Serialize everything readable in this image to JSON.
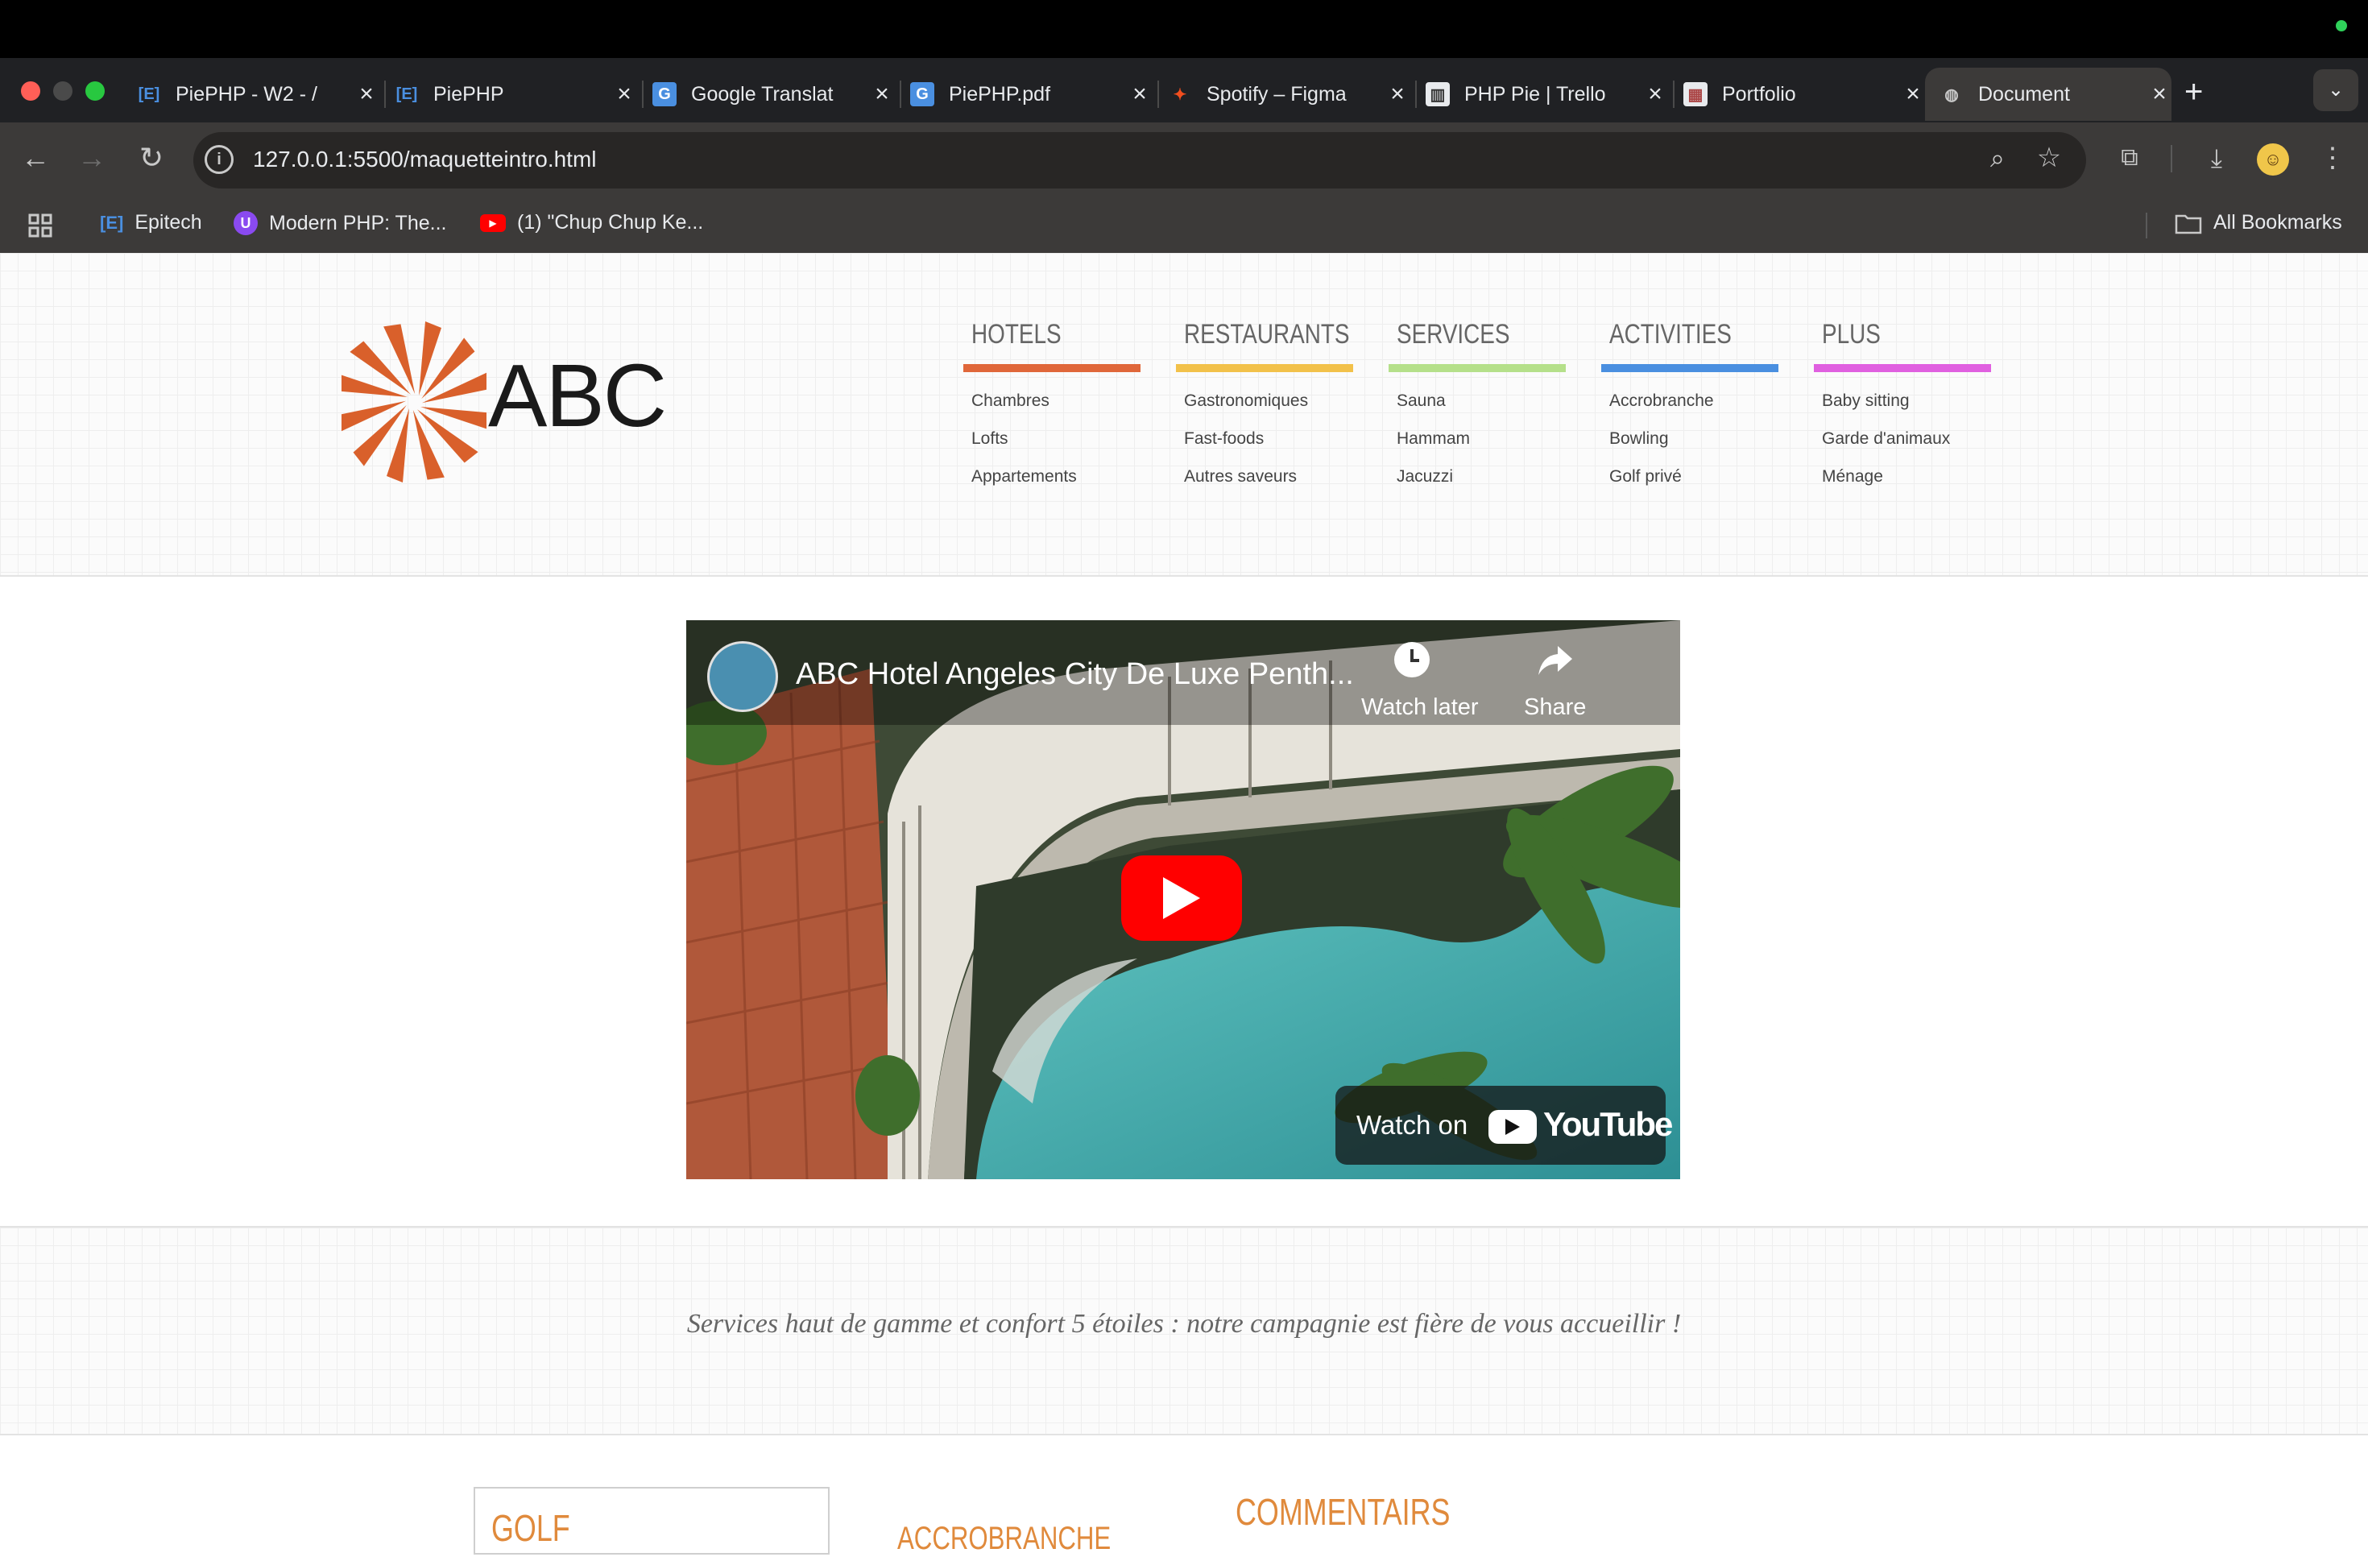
{
  "browser": {
    "tabs": [
      {
        "label": "PiePHP - W2 - /",
        "icon": "epitech-icon",
        "active": false
      },
      {
        "label": "PiePHP",
        "icon": "epitech-icon",
        "active": false
      },
      {
        "label": "Google Translat",
        "icon": "google-translate-icon",
        "active": false
      },
      {
        "label": "PiePHP.pdf",
        "icon": "google-translate-icon",
        "active": false
      },
      {
        "label": "Spotify – Figma",
        "icon": "figma-icon",
        "active": false
      },
      {
        "label": "PHP Pie | Trello",
        "icon": "trello-icon",
        "active": false
      },
      {
        "label": "Portfolio",
        "icon": "portfolio-icon",
        "active": false
      },
      {
        "label": "Document",
        "icon": "globe-icon",
        "active": true
      }
    ],
    "url": "127.0.0.1:5500/maquetteintro.html",
    "bookmarks": [
      {
        "label": "Epitech",
        "icon": "epitech-icon"
      },
      {
        "label": "Modern PHP: The...",
        "icon": "udemy-icon"
      },
      {
        "label": "(1) \"Chup Chup Ke...",
        "icon": "youtube-icon"
      }
    ],
    "all_bookmarks_label": "All Bookmarks"
  },
  "site": {
    "logo_text": "ABC",
    "nav": [
      {
        "title": "HOTELS",
        "color": "#e0673a",
        "items": [
          "Chambres",
          "Lofts",
          "Appartements"
        ]
      },
      {
        "title": "RESTAURANTS",
        "color": "#f2c14a",
        "items": [
          "Gastronomiques",
          "Fast-foods",
          "Autres saveurs"
        ]
      },
      {
        "title": "SERVICES",
        "color": "#b5e08a",
        "items": [
          "Sauna",
          "Hammam",
          "Jacuzzi"
        ]
      },
      {
        "title": "ACTIVITIES",
        "color": "#4a8fe0",
        "items": [
          "Accrobranche",
          "Bowling",
          "Golf privé"
        ]
      },
      {
        "title": "PLUS",
        "color": "#e060e0",
        "items": [
          "Baby sitting",
          "Garde d'animaux",
          "Ménage"
        ]
      }
    ],
    "video": {
      "title": "ABC Hotel Angeles City De Luxe Penth...",
      "watch_later": "Watch later",
      "share": "Share",
      "watch_on": "Watch on",
      "youtube": "YouTube"
    },
    "slogan": "Services haut de gamme et confort 5 étoiles : notre campagnie est fière de vous accueillir !",
    "sections": {
      "golf": "GOLF",
      "accrobranche": "ACCROBRANCHE",
      "commentairs": "COMMENTAIRS"
    }
  },
  "colors": {
    "accent_orange": "#e08a3c",
    "logo_orange": "#d9602b"
  }
}
